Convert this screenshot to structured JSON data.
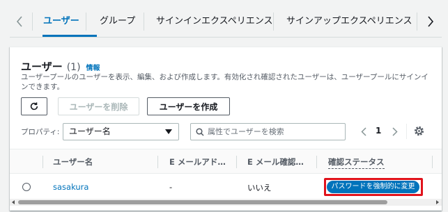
{
  "tabs": {
    "items": [
      {
        "label": "ユーザー",
        "active": true
      },
      {
        "label": "グループ",
        "active": false
      },
      {
        "label": "サインインエクスペリエンス",
        "active": false
      },
      {
        "label": "サインアップエクスペリエンス",
        "active": false
      }
    ],
    "left_icon": "chevron-left-icon",
    "right_icon": "chevron-right-icon"
  },
  "panel": {
    "title": "ユーザー",
    "count": "(1)",
    "info_link": "情報",
    "description": "ユーザープールのユーザーを表示、編集、および作成します。有効化され確認されたユーザーは、ユーザープールにサインインできます。"
  },
  "toolbar": {
    "refresh_icon": "refresh-icon",
    "delete_label": "ユーザーを削除",
    "create_label": "ユーザーを作成"
  },
  "filter": {
    "property_label": "プロパティ:",
    "property_value": "ユーザー名",
    "search_placeholder": "属性でユーザーを検索",
    "search_value": "",
    "page": "1"
  },
  "table": {
    "columns": [
      "ユーザー名",
      "E メールアド…",
      "E メール確認…",
      "確認ステータス"
    ],
    "rows": [
      {
        "username": "sasakura",
        "email": "-",
        "email_verified": "いいえ",
        "status": "パスワードを強制的に変更"
      }
    ]
  },
  "colors": {
    "accent": "#0073bb",
    "highlight": "#e0131c",
    "background": "#f2f3f3"
  }
}
